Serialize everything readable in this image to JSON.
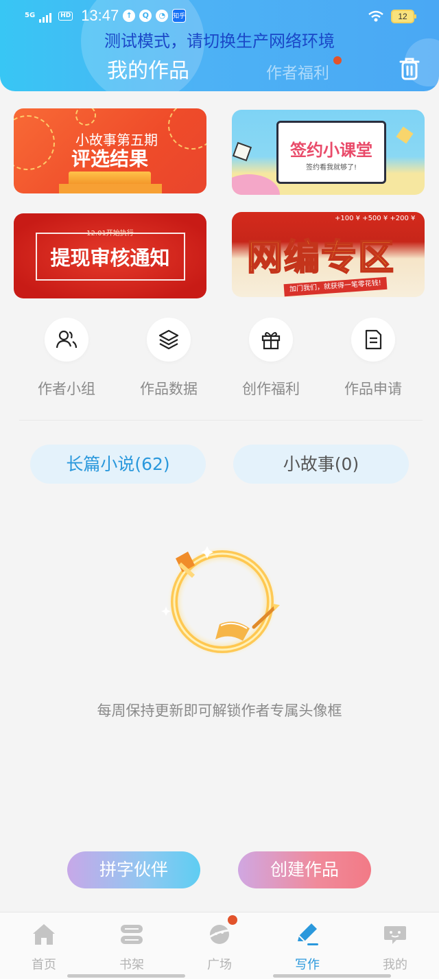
{
  "status_bar": {
    "network": "5G",
    "hd": "HD",
    "time": "13:47",
    "app_badge": "知乎",
    "battery": "12"
  },
  "header": {
    "test_notice": "测试模式，请切换生产网络环境",
    "title": "我的作品",
    "welfare_tab": "作者福利"
  },
  "banners": [
    {
      "line1": "小故事第五期",
      "line2": "评选结果"
    },
    {
      "title": "签约小课堂",
      "subtitle": "签约看我就够了!"
    },
    {
      "date": "12.01开始执行",
      "title": "提现审核通知"
    },
    {
      "money": "+100 ¥   +500 ¥   +200 ¥",
      "title": "网编专区",
      "ribbon": "加门我们，就获得一笔零花钱!"
    }
  ],
  "quick_menu": [
    {
      "label": "作者小组",
      "icon": "author-group-icon"
    },
    {
      "label": "作品数据",
      "icon": "layers-icon"
    },
    {
      "label": "创作福利",
      "icon": "gift-icon"
    },
    {
      "label": "作品申请",
      "icon": "document-icon"
    }
  ],
  "tabs": {
    "long_novel": "长篇小说(62)",
    "short_story": "小故事(0)"
  },
  "empty_state": {
    "text": "每周保持更新即可解锁作者专属头像框"
  },
  "actions": {
    "partner": "拼字伙伴",
    "create": "创建作品"
  },
  "bottom_nav": [
    {
      "label": "首页",
      "icon": "home-icon",
      "active": false
    },
    {
      "label": "书架",
      "icon": "bookshelf-icon",
      "active": false
    },
    {
      "label": "广场",
      "icon": "planet-icon",
      "active": false
    },
    {
      "label": "写作",
      "icon": "pen-icon",
      "active": true
    },
    {
      "label": "我的",
      "icon": "chat-face-icon",
      "active": false
    }
  ],
  "colors": {
    "header_blue": "#4db2f5",
    "accent_blue": "#2a98dc",
    "notice_text": "#1a47c7",
    "red_dot": "#e2532b"
  }
}
